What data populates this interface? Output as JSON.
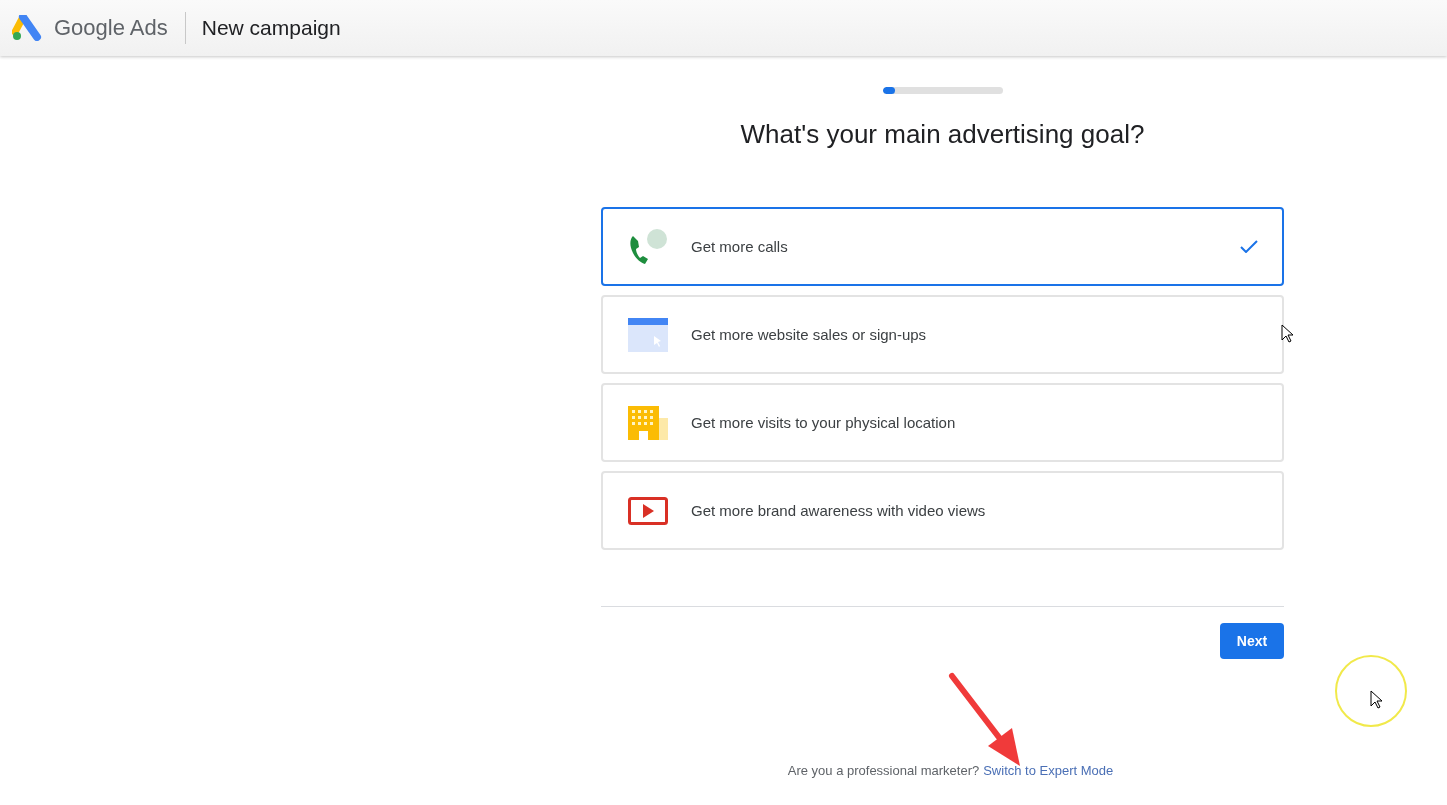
{
  "header": {
    "brand": "Google Ads",
    "title": "New campaign"
  },
  "progress": {
    "level": 0.1
  },
  "heading": "What's your main advertising goal?",
  "goals": [
    {
      "kind": "calls",
      "label": "Get more calls",
      "selected": true
    },
    {
      "kind": "website",
      "label": "Get more website sales or sign-ups",
      "selected": false
    },
    {
      "kind": "store",
      "label": "Get more visits to your physical location",
      "selected": false
    },
    {
      "kind": "video",
      "label": "Get more brand awareness with video views",
      "selected": false
    }
  ],
  "next_button": "Next",
  "footer": {
    "prompt": "Are you a professional marketer?",
    "link": "Switch to Expert Mode"
  }
}
